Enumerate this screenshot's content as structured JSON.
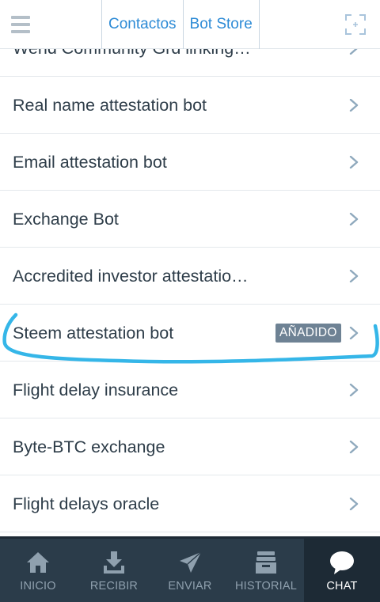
{
  "header": {
    "tabs": [
      {
        "label": "Contactos"
      },
      {
        "label": "Bot Store"
      }
    ]
  },
  "bots": [
    {
      "label": "Wend Community Grd linking…"
    },
    {
      "label": "Real name attestation bot"
    },
    {
      "label": "Email attestation bot"
    },
    {
      "label": "Exchange Bot"
    },
    {
      "label": "Accredited investor attestatio…"
    },
    {
      "label": "Steem attestation bot",
      "badge": "AÑADIDO"
    },
    {
      "label": "Flight delay insurance"
    },
    {
      "label": "Byte-BTC exchange"
    },
    {
      "label": "Flight delays oracle"
    }
  ],
  "nav": {
    "items": [
      {
        "label": "INICIO",
        "icon": "home-icon"
      },
      {
        "label": "RECIBIR",
        "icon": "download-icon"
      },
      {
        "label": "ENVIAR",
        "icon": "send-icon"
      },
      {
        "label": "HISTORIAL",
        "icon": "history-icon"
      },
      {
        "label": "CHAT",
        "icon": "chat-icon"
      }
    ],
    "active": "CHAT"
  },
  "colors": {
    "accent": "#2d8bd6",
    "highlight_stroke": "#35b6e8",
    "nav_bg": "#2b3c4a",
    "badge_bg": "#6e8294"
  }
}
